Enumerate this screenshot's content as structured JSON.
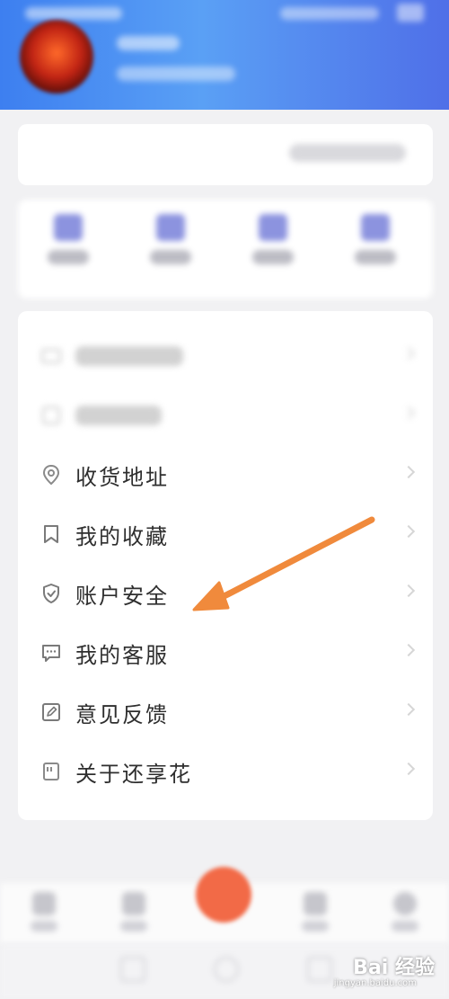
{
  "header": {
    "accent_color": "#4a8ef2"
  },
  "orders": {
    "title": "",
    "view_all": ""
  },
  "order_status": [
    {
      "label": "",
      "icon": "order-status-icon"
    },
    {
      "label": "",
      "icon": "order-status-icon"
    },
    {
      "label": "",
      "icon": "order-status-icon"
    },
    {
      "label": "",
      "icon": "order-status-icon"
    }
  ],
  "menu": {
    "items": [
      {
        "label": "",
        "icon": "card-icon"
      },
      {
        "label": "",
        "icon": "history-icon"
      },
      {
        "label": "收货地址",
        "icon": "location-pin-icon"
      },
      {
        "label": "我的收藏",
        "icon": "bookmark-icon"
      },
      {
        "label": "账户安全",
        "icon": "shield-icon"
      },
      {
        "label": "我的客服",
        "icon": "chat-icon"
      },
      {
        "label": "意见反馈",
        "icon": "edit-icon"
      },
      {
        "label": "关于还享花",
        "icon": "info-doc-icon"
      }
    ]
  },
  "tabbar": {
    "tabs": [
      {
        "label": "",
        "icon": "home-icon"
      },
      {
        "label": "",
        "icon": "category-icon"
      },
      {
        "label": "",
        "icon": "center-action-icon"
      },
      {
        "label": "",
        "icon": "cart-icon"
      },
      {
        "label": "",
        "icon": "profile-icon"
      }
    ],
    "center_color": "#f26a47"
  },
  "annotation": {
    "arrow_color": "#f08a3c"
  },
  "watermark": {
    "brand": "Bai 经验",
    "url": "jingyan.baidu.com"
  }
}
